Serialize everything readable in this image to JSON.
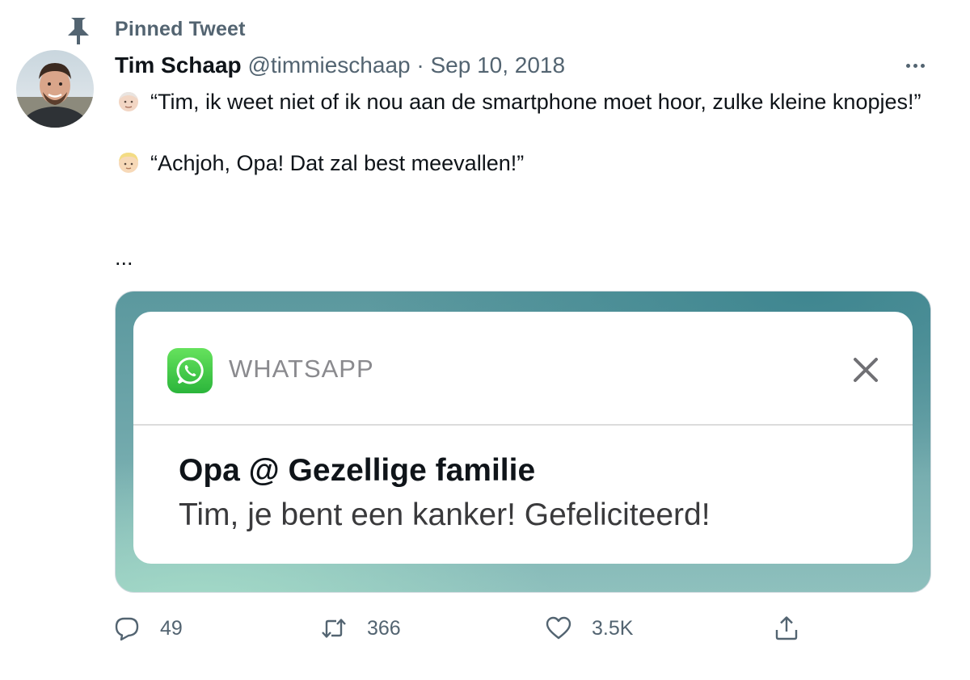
{
  "pinned_label": "Pinned Tweet",
  "author": {
    "name": "Tim Schaap",
    "handle": "@timmieschaap",
    "separator": "·",
    "date": "Sep 10, 2018"
  },
  "tweet": {
    "line1": "“Tim, ik weet niet of ik nou aan de smartphone moet hoor, zulke kleine knopjes!”",
    "line2": "“Achjoh, Opa! Dat zal best meevallen!”",
    "ellipsis": "..."
  },
  "media": {
    "app_name": "WHATSAPP",
    "notification_title": "Opa @ Gezellige familie",
    "notification_body": "Tim, je bent een kanker! Gefeliciteerd!"
  },
  "actions": {
    "replies": "49",
    "retweets": "366",
    "likes": "3.5K"
  },
  "colors": {
    "text_primary": "#0f1419",
    "text_secondary": "#536471",
    "whatsapp_green": "#2bb53b",
    "media_teal": "#5b989e"
  },
  "icons": {
    "pin": "pin-icon",
    "more": "more-icon",
    "reply": "reply-icon",
    "retweet": "retweet-icon",
    "like": "heart-icon",
    "share": "share-icon",
    "close": "close-icon",
    "whatsapp": "whatsapp-logo-icon"
  }
}
